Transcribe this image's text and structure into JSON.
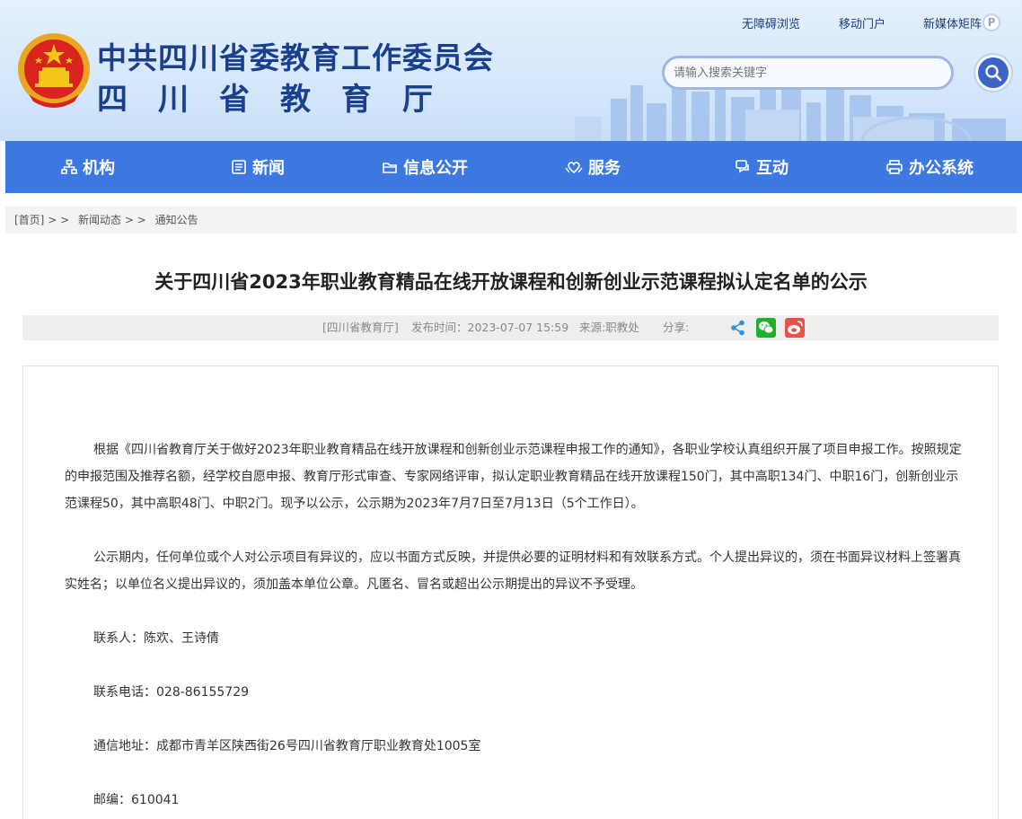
{
  "header": {
    "title": "中共四川省委教育工作委员会",
    "subtitle": "四川省教育厅",
    "top_links": [
      "无障碍浏览",
      "移动门户",
      "新媒体矩阵"
    ],
    "search_placeholder": "请输入搜索关键字"
  },
  "nav": {
    "items": [
      {
        "label": "机构",
        "icon": "org-chart-icon"
      },
      {
        "label": "新闻",
        "icon": "newspaper-icon"
      },
      {
        "label": "信息公开",
        "icon": "folder-icon"
      },
      {
        "label": "服务",
        "icon": "heart-hands-icon"
      },
      {
        "label": "互动",
        "icon": "chat-icon"
      },
      {
        "label": "办公系统",
        "icon": "printer-icon"
      }
    ]
  },
  "breadcrumb": {
    "home": "[首页]",
    "sep1": "> >",
    "level1": "新闻动态",
    "sep2": "> >",
    "level2": "通知公告"
  },
  "article": {
    "title": "关于四川省2023年职业教育精品在线开放课程和创新创业示范课程拟认定名单的公示",
    "meta": {
      "source_org": "[四川省教育厅]",
      "publish_time": "发布时间：2023-07-07 15:59",
      "source": "来源:职教处",
      "share_label": "分享:"
    },
    "paragraphs": [
      "根据《四川省教育厅关于做好2023年职业教育精品在线开放课程和创新创业示范课程申报工作的通知》，各职业学校认真组织开展了项目申报工作。按照规定的申报范围及推荐名额，经学校自愿申报、教育厅形式审查、专家网络评审，拟认定职业教育精品在线开放课程150门，其中高职134门、中职16门，创新创业示范课程50，其中高职48门、中职2门。现予以公示，公示期为2023年7月7日至7月13日（5个工作日）。",
      "公示期内，任何单位或个人对公示项目有异议的，应以书面方式反映，并提供必要的证明材料和有效联系方式。个人提出异议的，须在书面异议材料上签署真实姓名；以单位名义提出异议的，须加盖本单位公章。凡匿名、冒名或超出公示期提出的异议不予受理。",
      "联系人：陈欢、王诗倩",
      "联系电话：028-86155729",
      "通信地址：成都市青羊区陕西街26号四川省教育厅职业教育处1005室",
      "邮编：610041"
    ]
  },
  "colors": {
    "nav_bg": "#3d78e0",
    "title_blue": "#1a3f8c",
    "wechat_green": "#20b030",
    "weibo_red": "#e8524a"
  }
}
